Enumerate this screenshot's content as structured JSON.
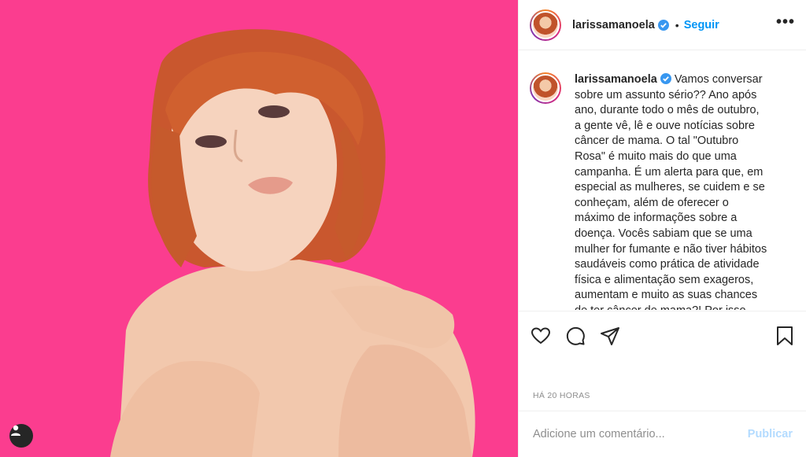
{
  "post": {
    "username": "larissamanoela",
    "follow_label": "Seguir",
    "separator": "•",
    "more_label": "•••",
    "caption": "Vamos conversar sobre um assunto sério?? Ano após ano, durante todo o mês de outubro, a gente vê, lê e ouve notícias sobre câncer de mama. O tal \"Outubro Rosa\" é muito mais do que uma campanha. É um alerta para que, em especial as mulheres, se cuidem e se conheçam, além de oferecer o máximo de informações sobre a doença. Vocês sabiam que se uma mulher for fumante e não tiver hábitos saudáveis como prática de atividade física e alimentação sem exageros, aumentam e muito as suas chances de ter câncer de mama?! Por isso, cuide-se e procure seu médico.",
    "timestamp": "HÁ 20 HORAS"
  },
  "comment": {
    "placeholder": "Adicione um comentário...",
    "publish_label": "Publicar"
  },
  "colors": {
    "photo_background": "#fb3d8f",
    "link_blue": "#0095f6",
    "verified_blue": "#3897f0"
  },
  "icons": {
    "verified": "verified-badge-icon",
    "like": "heart-icon",
    "comment": "comment-icon",
    "share": "paper-plane-icon",
    "save": "bookmark-icon",
    "tagged": "user-tag-icon"
  }
}
